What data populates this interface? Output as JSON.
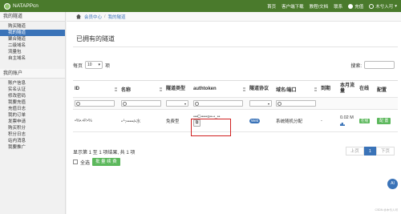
{
  "navbar": {
    "brand": "NATAPPcn",
    "links": [
      "首页",
      "客户端下载",
      "教程/文档",
      "联系"
    ],
    "recharge": "充值",
    "user": "木兮入可"
  },
  "sidebar": {
    "section1": "我的隧道",
    "tunnel_items": [
      "购买隧道",
      "我的隧道",
      "聚合隧道",
      "二级域名",
      "流量包",
      "自主域名"
    ],
    "section2": "我的账户",
    "account_items": [
      "账户信息",
      "实名认证",
      "修改密码",
      "我要充值",
      "充值日志",
      "我的订单",
      "发票申请",
      "购买积分",
      "积分日志",
      "站内消息",
      "我要推广"
    ]
  },
  "breadcrumb": {
    "home": "会员中心",
    "current": "我的隧道"
  },
  "page_title": "已拥有的隧道",
  "length_control": {
    "prefix": "每页",
    "value": "10",
    "suffix": "项"
  },
  "search": {
    "label": "搜索:"
  },
  "table": {
    "headers": {
      "id": "ID",
      "name": "名称",
      "type": "隧道类型",
      "authtoken": "authtoken",
      "protocol": "隧道协议",
      "domain": "域名/端口",
      "expire": "到期",
      "traffic": "本月流量",
      "online": "在线",
      "config": "配置"
    },
    "rows": [
      {
        "id": "•%•.•P.•%",
        "name": "•ㄣ•••••/•水",
        "type": "免费型",
        "authtoken": "•••C•••••s••-•_••",
        "protocol": "Web",
        "domain": "系统随机分配",
        "expire": "-",
        "traffic": "0.02 M",
        "online": "在线",
        "config": "配 置"
      }
    ]
  },
  "info": "显示第 1 至 1 项结果, 共 1 项",
  "bulk": {
    "select_all": "全选",
    "button": "批 量 续 费"
  },
  "pager": {
    "prev": "上页",
    "current": "1",
    "next": "下页"
  },
  "float_button": "AI",
  "footer": "CSDN @木兮入可"
}
